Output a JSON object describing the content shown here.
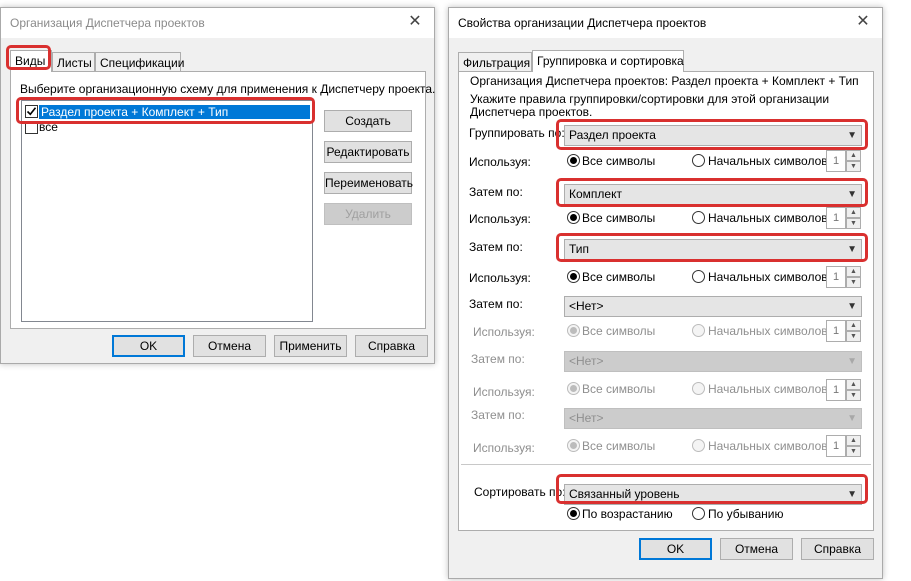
{
  "left_dialog": {
    "title": "Организация Диспетчера проектов",
    "tabs": [
      "Виды",
      "Листы",
      "Спецификации"
    ],
    "instruction": "Выберите организационную схему для применения к Диспетчеру проекта.",
    "schemes": [
      {
        "label": "Раздел проекта + Комплект + Тип",
        "checked": true,
        "selected": true
      },
      {
        "label": "все",
        "checked": false,
        "selected": false
      }
    ],
    "buttons": {
      "create": "Создать",
      "edit": "Редактировать",
      "rename": "Переименовать",
      "delete": "Удалить"
    },
    "footer": {
      "ok": "OK",
      "cancel": "Отмена",
      "apply": "Применить",
      "help": "Справка"
    }
  },
  "right_dialog": {
    "title": "Свойства организации Диспетчера проектов",
    "tabs": [
      "Фильтрация",
      "Группировка и сортировка"
    ],
    "org_line": "Организация Диспетчера проектов: Раздел проекта + Комплект + Тип",
    "instruction_1": "Укажите правила группировки/сортировки для этой организации",
    "instruction_2": "Диспетчера проектов.",
    "using_label": "Используя:",
    "all_chars": "Все символы",
    "leading_chars": "Начальных символов",
    "groups": [
      {
        "label": "Группировать по:",
        "value": "Раздел проекта",
        "count": "1"
      },
      {
        "label": "Затем по:",
        "value": "Комплект",
        "count": "1"
      },
      {
        "label": "Затем по:",
        "value": "Тип",
        "count": "1"
      },
      {
        "label": "Затем по:",
        "value": "<Нет>",
        "count": "1"
      },
      {
        "label": "Затем по:",
        "value": "<Нет>",
        "count": "1"
      },
      {
        "label": "Затем по:",
        "value": "<Нет>",
        "count": "1"
      }
    ],
    "sort_label": "Сортировать по:",
    "sort_value": "Связанный уровень",
    "ascending": "По возрастанию",
    "descending": "По убыванию",
    "footer": {
      "ok": "OK",
      "cancel": "Отмена",
      "help": "Справка"
    }
  },
  "colors": {
    "highlight": "#d9302f",
    "selection": "#0078d7"
  }
}
